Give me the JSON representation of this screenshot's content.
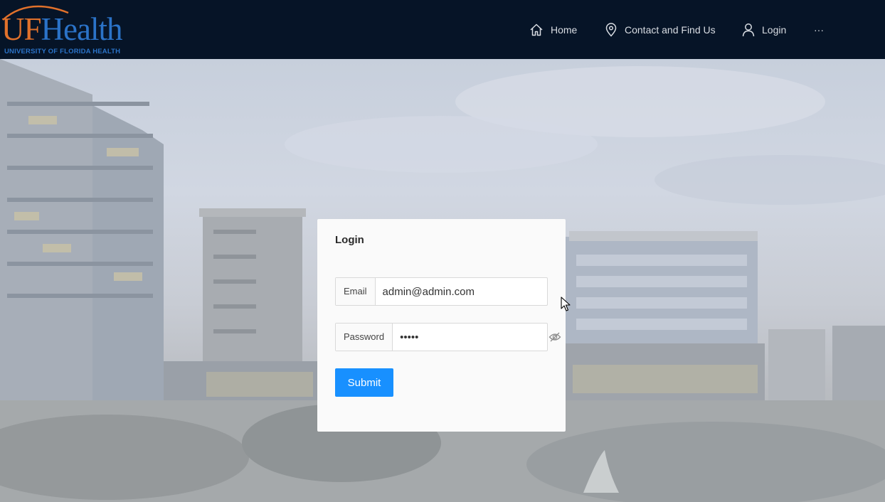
{
  "brand": {
    "logo_mark_uf": "UF",
    "logo_mark_health": "Health",
    "logo_subtitle": "UNIVERSITY OF FLORIDA HEALTH"
  },
  "nav": {
    "items": [
      {
        "label": "Home",
        "icon": "home-icon"
      },
      {
        "label": "Contact and Find Us",
        "icon": "location-pin-icon"
      },
      {
        "label": "Login",
        "icon": "user-icon"
      }
    ],
    "more_label": "···"
  },
  "login_form": {
    "title": "Login",
    "email": {
      "label": "Email",
      "value": "admin@admin.com"
    },
    "password": {
      "label": "Password",
      "value": "•••••",
      "visibility_icon": "eye-hidden-icon"
    },
    "submit_label": "Submit"
  },
  "colors": {
    "header_bg": "#061427",
    "brand_orange": "#e1712b",
    "brand_blue": "#2b73c8",
    "primary_button": "#1890ff"
  }
}
